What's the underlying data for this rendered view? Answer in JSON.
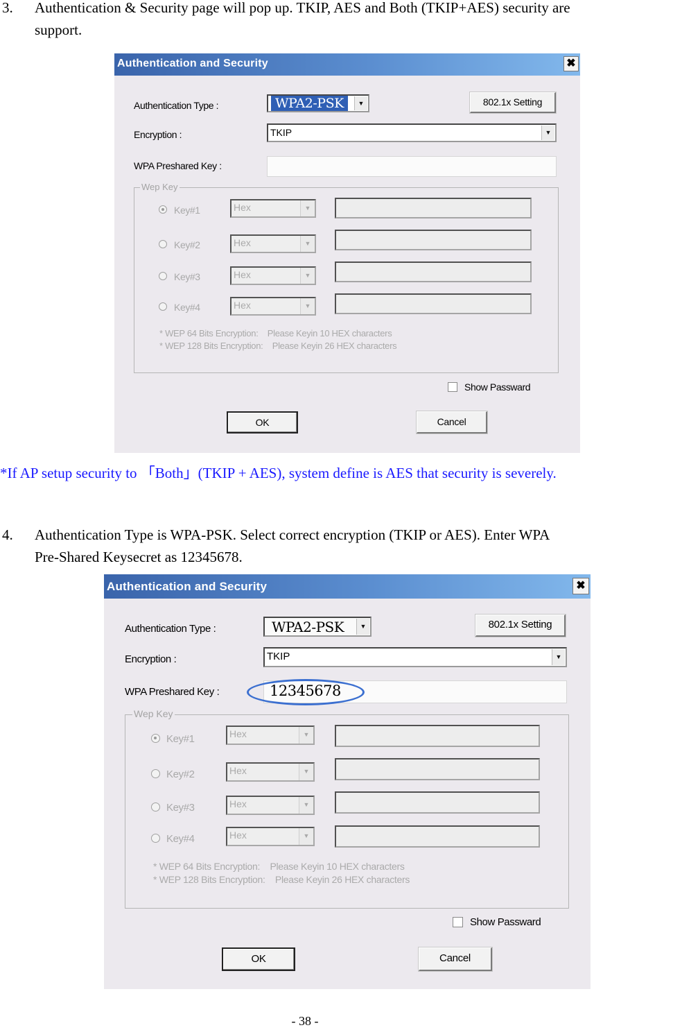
{
  "step3": {
    "number": "3.",
    "line1": "Authentication & Security page will pop up. TKIP, AES and Both (TKIP+AES) security are",
    "line2": "support."
  },
  "note": "*If AP setup security to 「Both」(TKIP + AES), system define is AES that security is severely.",
  "step4": {
    "number": "4.",
    "line1": "Authentication Type is WPA-PSK. Select correct encryption (TKIP or AES). Enter WPA",
    "line2": "Pre-Shared Keysecret as 12345678."
  },
  "dialogs": [
    {
      "title": "Authentication and Security",
      "close_icon": "✖",
      "auth_type_label": "Authentication Type :",
      "auth_type_value": "WPA2-PSK",
      "setting_button": "802.1x Setting",
      "encryption_label": "Encryption :",
      "encryption_value": "TKIP",
      "psk_label": "WPA Preshared Key :",
      "psk_value": "",
      "wep_group_label": "Wep Key",
      "keys": [
        {
          "label": "Key#1",
          "format": "Hex",
          "value": "",
          "selected": true
        },
        {
          "label": "Key#2",
          "format": "Hex",
          "value": "",
          "selected": false
        },
        {
          "label": "Key#3",
          "format": "Hex",
          "value": "",
          "selected": false
        },
        {
          "label": "Key#4",
          "format": "Hex",
          "value": "",
          "selected": false
        }
      ],
      "hint1": "* WEP 64 Bits Encryption:    Please Keyin 10 HEX characters",
      "hint2": "* WEP 128 Bits Encryption:    Please Keyin 26 HEX characters",
      "show_password_label": "Show Passward",
      "show_password_checked": false,
      "ok_button": "OK",
      "cancel_button": "Cancel"
    },
    {
      "title": "Authentication and Security",
      "close_icon": "✖",
      "auth_type_label": "Authentication Type :",
      "auth_type_value": "WPA2-PSK",
      "setting_button": "802.1x Setting",
      "encryption_label": "Encryption :",
      "encryption_value": "TKIP",
      "psk_label": "WPA Preshared Key :",
      "psk_value": "12345678",
      "wep_group_label": "Wep Key",
      "keys": [
        {
          "label": "Key#1",
          "format": "Hex",
          "value": "",
          "selected": true
        },
        {
          "label": "Key#2",
          "format": "Hex",
          "value": "",
          "selected": false
        },
        {
          "label": "Key#3",
          "format": "Hex",
          "value": "",
          "selected": false
        },
        {
          "label": "Key#4",
          "format": "Hex",
          "value": "",
          "selected": false
        }
      ],
      "hint1": "* WEP 64 Bits Encryption:    Please Keyin 10 HEX characters",
      "hint2": "* WEP 128 Bits Encryption:    Please Keyin 26 HEX characters",
      "show_password_label": "Show Passward",
      "show_password_checked": false,
      "ok_button": "OK",
      "cancel_button": "Cancel"
    }
  ],
  "footer": "- 38 -"
}
